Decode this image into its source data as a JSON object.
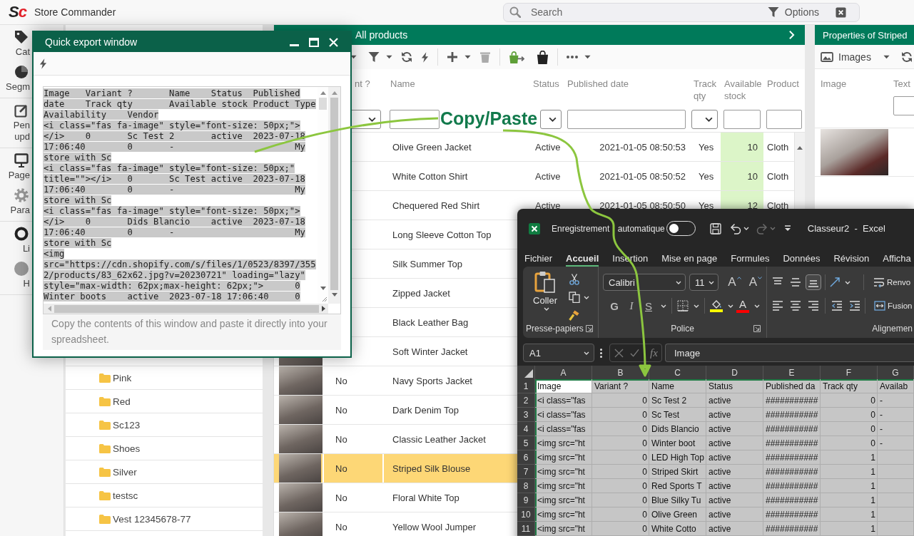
{
  "top_bar": {
    "logo": "Sc",
    "app_name": "Store Commander",
    "search": {
      "placeholder": "Search"
    },
    "options_label": "Options"
  },
  "sidebar": {
    "groups": [
      {
        "items": [
          {
            "label": "Cat"
          },
          {
            "label": "Segm"
          }
        ]
      },
      {
        "items": [
          {
            "label": "Pen upd"
          }
        ]
      },
      {
        "items": [
          {
            "label": "Page"
          },
          {
            "label": "Para"
          }
        ]
      },
      {
        "items": [
          {
            "label": "Li"
          },
          {
            "label": "H"
          }
        ]
      }
    ]
  },
  "tree": {
    "items": [
      "Pink",
      "Red",
      "Sc123",
      "Shoes",
      "Silver",
      "testsc",
      "Vest 12345678-77"
    ]
  },
  "products": {
    "title": "All products",
    "columns": [
      {
        "label": "nt ?",
        "kind": "select"
      },
      {
        "label": "Name",
        "kind": "text"
      },
      {
        "label": "Status",
        "kind": "select"
      },
      {
        "label": "Published date",
        "kind": "text"
      },
      {
        "label": "Track qty",
        "kind": "select"
      },
      {
        "label": "Available stock",
        "kind": "text"
      },
      {
        "label": "Product",
        "kind": "text"
      }
    ],
    "rows": [
      {
        "name": "Olive Green Jacket",
        "status": "Active",
        "published": "2021-01-05 08:50:53",
        "track_qty": "Yes",
        "stock": "10",
        "type": "Cloth",
        "photo": false,
        "selected": false
      },
      {
        "name": "White Cotton Shirt",
        "status": "Active",
        "published": "2021-01-05 08:50:52",
        "track_qty": "Yes",
        "stock": "10",
        "type": "Cloth",
        "photo": false,
        "selected": false
      },
      {
        "name": "Chequered Red Shirt",
        "status": "Active",
        "published": "2021-01-05 08:50:50",
        "track_qty": "Yes",
        "stock": "12",
        "type": "Cloth",
        "photo": false,
        "selected": false
      },
      {
        "name": "Long Sleeve Cotton Top",
        "photo": false,
        "selected": false
      },
      {
        "name": "Silk Summer Top",
        "photo": false,
        "selected": false
      },
      {
        "name": "Zipped Jacket",
        "photo": false,
        "selected": false
      },
      {
        "name": "Black Leather Bag",
        "photo": false,
        "selected": false
      },
      {
        "name": "Soft Winter Jacket",
        "photo": true,
        "selected": false
      },
      {
        "name": "Navy Sports Jacket",
        "variant": "No",
        "photo": true,
        "selected": false
      },
      {
        "name": "Dark Denim Top",
        "variant": "No",
        "photo": true,
        "selected": false
      },
      {
        "name": "Classic Leather Jacket",
        "variant": "No",
        "photo": true,
        "selected": false
      },
      {
        "name": "Striped Silk Blouse",
        "variant": "No",
        "photo": true,
        "selected": true
      },
      {
        "name": "Floral White Top",
        "variant": "No",
        "photo": true,
        "selected": false
      },
      {
        "name": "Yellow Wool Jumper",
        "variant": "No",
        "photo": true,
        "selected": false
      }
    ]
  },
  "properties": {
    "title": "Properties of Striped",
    "view": "Images",
    "columns": [
      {
        "label": "Image"
      },
      {
        "label": "Text",
        "kind": "text"
      }
    ]
  },
  "quick_export": {
    "title": "Quick export window",
    "text_selected": true,
    "lines": [
      "Image   Variant ?       Name    Status  Published",
      "date    Track qty       Available stock Product Type",
      "Availability    Vendor",
      "<i class=\"fas fa-image\" style=\"font-size: 50px;\">",
      "</i>    0       Sc Test 2       active  2023-07-18",
      "17:06:40        0       -                       My",
      "store with Sc",
      "<i class=\"fas fa-image\" style=\"font-size: 50px;\"",
      "title=\"\"></i>   0       Sc Test active  2023-07-18",
      "17:06:40        0       -                       My",
      "store with Sc",
      "<i class=\"fas fa-image\" style=\"font-size: 50px;\">",
      "</i>    0       Dids Blancio    active  2023-07-18",
      "17:06:40        0       -                       My",
      "store with Sc",
      "<img",
      "src=\"https://cdn.shopify.com/s/files/1/0523/8397/355",
      "2/products/83_62x62.jpg?v=20230721\" loading=\"lazy\"",
      "style=\"max-width: 62px;max-height: 62px;\">      0",
      "Winter boots    active  2023-07-18 17:06:40     0"
    ],
    "hint": "Copy the contents of this window and paste it directly into your spreadsheet."
  },
  "annotation": {
    "label": "Copy/Paste"
  },
  "excel": {
    "autosave_label": "Enregistrement automatique",
    "autosave_on": false,
    "redo_disabled": true,
    "title": "Classeur2  -  Excel",
    "tabs": [
      {
        "label": "Fichier",
        "selected": false
      },
      {
        "label": "Accueil",
        "selected": true
      },
      {
        "label": "Insertion",
        "selected": false
      },
      {
        "label": "Mise en page",
        "selected": false
      },
      {
        "label": "Formules",
        "selected": false
      },
      {
        "label": "Données",
        "selected": false
      },
      {
        "label": "Révision",
        "selected": false
      },
      {
        "label": "Afficha",
        "selected": false
      }
    ],
    "clipboard": {
      "paste_label": "Coller",
      "group_label": "Presse-papiers"
    },
    "font": {
      "family": "Calibri",
      "size": "11",
      "grow": "A",
      "shrink": "A",
      "bold": "G",
      "italic": "I",
      "underline": "S",
      "highlight": {
        "color": "#ffff00"
      },
      "text_color": {
        "label": "A",
        "color": "#ff0000"
      },
      "group_label": "Police"
    },
    "alignment": {
      "vertical": [
        {
          "selected": false
        },
        {
          "selected": false
        },
        {
          "selected": true
        }
      ],
      "wrap_label": "Renvo",
      "merge_label": "Fusion",
      "group_label": "Alignemen"
    },
    "name_box": "A1",
    "function_label": "fx",
    "formula": "Image",
    "grid": {
      "columns": [
        "A",
        "B",
        "C",
        "D",
        "E",
        "F",
        "G"
      ],
      "rows": [
        {
          "number": "1",
          "selected": true,
          "cells": [
            {
              "text": "Image",
              "kind": "text",
              "active": true
            },
            {
              "text": "Variant ?",
              "kind": "text",
              "active": false
            },
            {
              "text": "Name",
              "kind": "text",
              "active": false
            },
            {
              "text": "Status",
              "kind": "text",
              "active": false
            },
            {
              "text": "Published da",
              "kind": "text",
              "active": false
            },
            {
              "text": "Track qty",
              "kind": "text",
              "active": false
            },
            {
              "text": "Availab",
              "kind": "text",
              "active": false
            }
          ]
        },
        {
          "number": "2",
          "selected": true,
          "cells": [
            {
              "text": "<i class=\"fas",
              "kind": "text",
              "active": false
            },
            {
              "text": "0",
              "kind": "number",
              "active": false
            },
            {
              "text": "Sc Test 2",
              "kind": "text",
              "active": false
            },
            {
              "text": "active",
              "kind": "text",
              "active": false
            },
            {
              "text": "###########",
              "kind": "text",
              "active": false
            },
            {
              "text": "0",
              "kind": "number",
              "active": false
            },
            {
              "text": "-",
              "kind": "text",
              "active": false
            }
          ]
        },
        {
          "number": "3",
          "selected": true,
          "cells": [
            {
              "text": "<i class=\"fas",
              "kind": "text",
              "active": false
            },
            {
              "text": "0",
              "kind": "number",
              "active": false
            },
            {
              "text": "Sc Test",
              "kind": "text",
              "active": false
            },
            {
              "text": "active",
              "kind": "text",
              "active": false
            },
            {
              "text": "###########",
              "kind": "text",
              "active": false
            },
            {
              "text": "0",
              "kind": "number",
              "active": false
            },
            {
              "text": "-",
              "kind": "text",
              "active": false
            }
          ]
        },
        {
          "number": "4",
          "selected": true,
          "cells": [
            {
              "text": "<i class=\"fas",
              "kind": "text",
              "active": false
            },
            {
              "text": "0",
              "kind": "number",
              "active": false
            },
            {
              "text": "Dids Blancio",
              "kind": "text",
              "active": false
            },
            {
              "text": "active",
              "kind": "text",
              "active": false
            },
            {
              "text": "###########",
              "kind": "text",
              "active": false
            },
            {
              "text": "0",
              "kind": "number",
              "active": false
            },
            {
              "text": "-",
              "kind": "text",
              "active": false
            }
          ]
        },
        {
          "number": "5",
          "selected": true,
          "cells": [
            {
              "text": "<img src=\"ht",
              "kind": "text",
              "active": false
            },
            {
              "text": "0",
              "kind": "number",
              "active": false
            },
            {
              "text": "Winter boot",
              "kind": "text",
              "active": false
            },
            {
              "text": "active",
              "kind": "text",
              "active": false
            },
            {
              "text": "###########",
              "kind": "text",
              "active": false
            },
            {
              "text": "0",
              "kind": "number",
              "active": false
            },
            {
              "text": "-",
              "kind": "text",
              "active": false
            }
          ]
        },
        {
          "number": "6",
          "selected": true,
          "cells": [
            {
              "text": "<img src=\"ht",
              "kind": "text",
              "active": false
            },
            {
              "text": "0",
              "kind": "number",
              "active": false
            },
            {
              "text": "LED High Top",
              "kind": "text",
              "active": false
            },
            {
              "text": "active",
              "kind": "text",
              "active": false
            },
            {
              "text": "###########",
              "kind": "text",
              "active": false
            },
            {
              "text": "1",
              "kind": "number",
              "active": false
            }
          ]
        },
        {
          "number": "7",
          "selected": true,
          "cells": [
            {
              "text": "<img src=\"ht",
              "kind": "text",
              "active": false
            },
            {
              "text": "0",
              "kind": "number",
              "active": false
            },
            {
              "text": "Striped Skirt",
              "kind": "text",
              "active": false
            },
            {
              "text": "active",
              "kind": "text",
              "active": false
            },
            {
              "text": "###########",
              "kind": "text",
              "active": false
            },
            {
              "text": "1",
              "kind": "number",
              "active": false
            }
          ]
        },
        {
          "number": "8",
          "selected": true,
          "cells": [
            {
              "text": "<img src=\"ht",
              "kind": "text",
              "active": false
            },
            {
              "text": "0",
              "kind": "number",
              "active": false
            },
            {
              "text": "Red Sports T",
              "kind": "text",
              "active": false
            },
            {
              "text": "active",
              "kind": "text",
              "active": false
            },
            {
              "text": "###########",
              "kind": "text",
              "active": false
            },
            {
              "text": "1",
              "kind": "number",
              "active": false
            }
          ]
        },
        {
          "number": "9",
          "selected": true,
          "cells": [
            {
              "text": "<img src=\"ht",
              "kind": "text",
              "active": false
            },
            {
              "text": "0",
              "kind": "number",
              "active": false
            },
            {
              "text": "Blue Silky Tu",
              "kind": "text",
              "active": false
            },
            {
              "text": "active",
              "kind": "text",
              "active": false
            },
            {
              "text": "###########",
              "kind": "text",
              "active": false
            },
            {
              "text": "1",
              "kind": "number",
              "active": false
            }
          ]
        },
        {
          "number": "10",
          "selected": true,
          "cells": [
            {
              "text": "<img src=\"ht",
              "kind": "text",
              "active": false
            },
            {
              "text": "0",
              "kind": "number",
              "active": false
            },
            {
              "text": "Olive Green",
              "kind": "text",
              "active": false
            },
            {
              "text": "active",
              "kind": "text",
              "active": false
            },
            {
              "text": "###########",
              "kind": "text",
              "active": false
            },
            {
              "text": "1",
              "kind": "number",
              "active": false
            }
          ]
        },
        {
          "number": "11",
          "selected": true,
          "cells": [
            {
              "text": "<img src=\"ht",
              "kind": "text",
              "active": false
            },
            {
              "text": "0",
              "kind": "number",
              "active": false
            },
            {
              "text": "White Cotto",
              "kind": "text",
              "active": false
            },
            {
              "text": "active",
              "kind": "text",
              "active": false
            },
            {
              "text": "###########",
              "kind": "text",
              "active": false
            },
            {
              "text": "1",
              "kind": "number",
              "active": false
            }
          ]
        }
      ]
    }
  }
}
